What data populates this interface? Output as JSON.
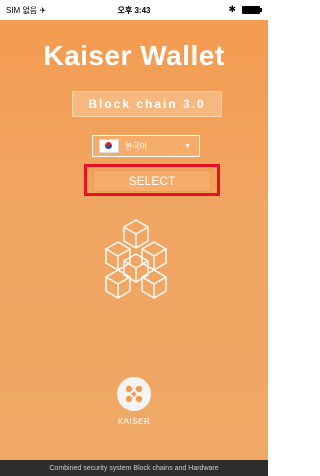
{
  "status_bar": {
    "carrier": "SIM 없음 ✈",
    "time": "오후 3:43",
    "bluetooth": "✱"
  },
  "app": {
    "title": "Kaiser Wallet",
    "subtitle": "Block chain 3.0",
    "language": {
      "selected": "한국어",
      "flag": "south-korea-flag",
      "arrow": "▼"
    },
    "select_button": "SELECT",
    "logo_text": "KAISER",
    "footer": "Combined security system Block chains and Hardware"
  },
  "colors": {
    "background": "#f49a4e",
    "highlight": "#e81123",
    "footer_bg": "#2d2d2d"
  }
}
